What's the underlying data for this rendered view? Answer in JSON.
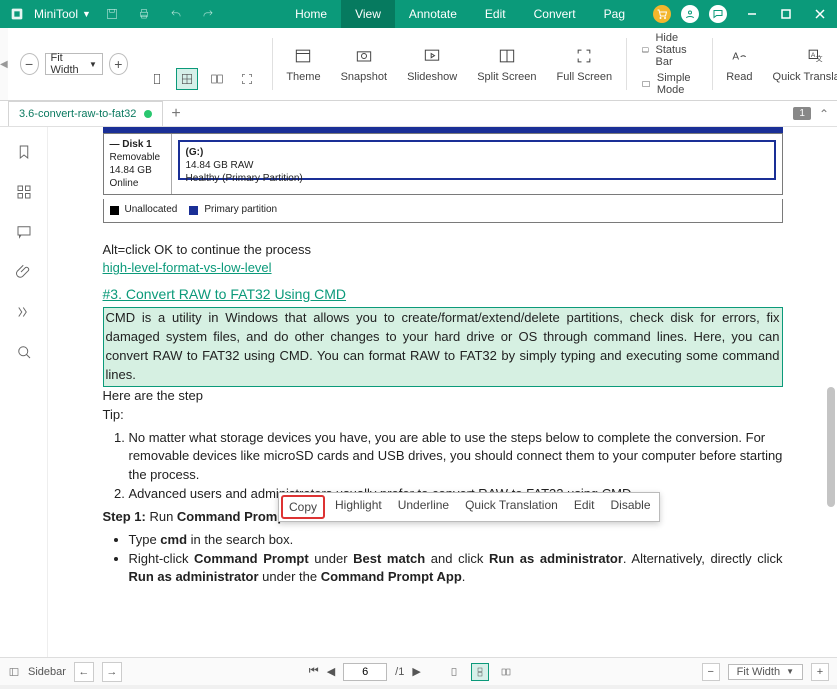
{
  "app": {
    "name": "MiniTool"
  },
  "menu": {
    "tabs": [
      "Home",
      "View",
      "Annotate",
      "Edit",
      "Convert",
      "Pag"
    ],
    "active_index": 1
  },
  "ribbon": {
    "fit_label": "Fit Width",
    "tools": {
      "theme": "Theme",
      "snapshot": "Snapshot",
      "slideshow": "Slideshow",
      "split": "Split Screen",
      "full": "Full Screen",
      "hide_status": "Hide Status Bar",
      "simple": "Simple Mode",
      "read": "Read",
      "quick_trans": "Quick Translation"
    }
  },
  "doc_tab": {
    "title": "3.6-convert-raw-to-fat32",
    "page_badge": "1"
  },
  "disk": {
    "title": "Disk 1",
    "type": "Removable",
    "size": "14.84 GB",
    "status": "Online",
    "vol_letter": "(G:)",
    "vol_size": "14.84 GB RAW",
    "vol_health": "Healthy (Primary Partition)",
    "legend_unalloc": "Unallocated",
    "legend_primary": "Primary partition"
  },
  "content": {
    "alt_line": "Alt=click OK to continue the process",
    "link1": "high-level-format-vs-low-level",
    "heading": "#3. Convert RAW to FAT32 Using CMD",
    "cmd_para": "CMD is a utility in Windows that allows you to create/format/extend/delete partitions, check disk for errors, fix damaged system files, and do other changes to your hard drive or OS through command lines. Here, you can convert RAW to FAT32 using CMD. You can format RAW to FAT32 by simply typing and executing some command lines.",
    "steps_lead": "Here are the step",
    "tip": "Tip:",
    "ol1": "No matter what storage devices you have, you are able to use the steps below to complete the conversion. For removable devices like microSD cards and USB drives, you should connect them to your computer before starting the process.",
    "ol2": "Advanced users and administrators usually prefer to convert RAW to FAT32 using CMD.",
    "step1_a": "Step 1:",
    "step1_b": " Run ",
    "step1_c": "Command Prompt",
    "step1_d": " as an administrator in the search box.",
    "b1_a": "Type ",
    "b1_b": "cmd",
    "b1_c": " in the search box.",
    "b2_a": "Right-click ",
    "b2_b": "Command Prompt",
    "b2_c": " under ",
    "b2_d": "Best match",
    "b2_e": " and click ",
    "b2_f": "Run as administrator",
    "b2_g": ". Alternatively, directly click ",
    "b2_h": "Run as administrator",
    "b2_i": " under the ",
    "b2_j": "Command Prompt App",
    "b2_k": "."
  },
  "ctx": {
    "copy": "Copy",
    "highlight": "Highlight",
    "underline": "Underline",
    "quick": "Quick Translation",
    "edit": "Edit",
    "disable": "Disable"
  },
  "status": {
    "sidebar": "Sidebar",
    "page_current": "6",
    "page_total": "/1",
    "fit": "Fit Width"
  }
}
